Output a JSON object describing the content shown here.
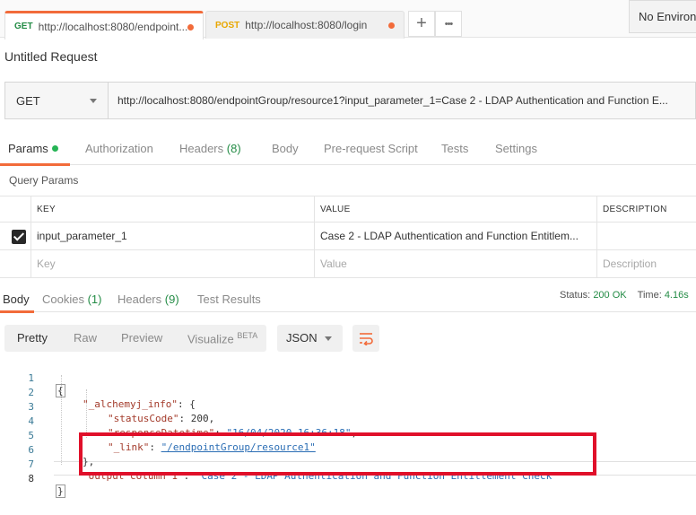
{
  "tabs": [
    {
      "method": "GET",
      "url": "http://localhost:8080/endpoint...",
      "active": true
    },
    {
      "method": "POST",
      "url": "http://localhost:8080/login",
      "active": false
    }
  ],
  "tab_actions": {
    "add": "+",
    "more": "•••"
  },
  "environment": {
    "label": "No Environ"
  },
  "request": {
    "title": "Untitled Request",
    "method": "GET",
    "url": "http://localhost:8080/endpointGroup/resource1?input_parameter_1=Case 2 - LDAP Authentication and Function E..."
  },
  "request_tabs": {
    "params": "Params",
    "authorization": "Authorization",
    "headers": "Headers",
    "headers_count": "(8)",
    "body": "Body",
    "prerequest": "Pre-request Script",
    "tests": "Tests",
    "settings": "Settings"
  },
  "query_params": {
    "label": "Query Params",
    "columns": {
      "key": "KEY",
      "value": "VALUE",
      "description": "DESCRIPTION"
    },
    "rows": [
      {
        "checked": true,
        "key": "input_parameter_1",
        "value": "Case 2 - LDAP Authentication and Function Entitlem...",
        "description": ""
      }
    ],
    "placeholders": {
      "key": "Key",
      "value": "Value",
      "description": "Description"
    }
  },
  "response_tabs": {
    "body": "Body",
    "cookies": "Cookies",
    "cookies_count": "(1)",
    "headers": "Headers",
    "headers_count": "(9)",
    "test_results": "Test Results"
  },
  "status": {
    "status_label": "Status:",
    "status_value": "200 OK",
    "time_label": "Time:",
    "time_value": "4.16s"
  },
  "viewer": {
    "pretty": "Pretty",
    "raw": "Raw",
    "preview": "Preview",
    "visualize": "Visualize",
    "beta": "BETA",
    "format": "JSON"
  },
  "code_lines": {
    "n1": "1",
    "n2": "2",
    "n3": "3",
    "n4": "4",
    "n5": "5",
    "n6": "6",
    "n7": "7",
    "n8": "8",
    "l1": "{",
    "l2_key": "\"_alchemyj_info\"",
    "l2_rest": ": {",
    "l3_key": "\"statusCode\"",
    "l3_val": "200",
    "l4_key": "\"responseDatetime\"",
    "l4_val": "\"16/04/2020 16:36:18\"",
    "l5_key": "\"_link\"",
    "l5_val": "\"/endpointGroup/resource1\"",
    "l6": "},",
    "l7_key": "\"output column 1\"",
    "l7_val": "\"Case 2 - LDAP Authentication and Function Entitlement Check\"",
    "l8": "}"
  },
  "colors": {
    "accent": "#f26b3a",
    "success": "#248c46",
    "highlight": "#e0102a"
  }
}
